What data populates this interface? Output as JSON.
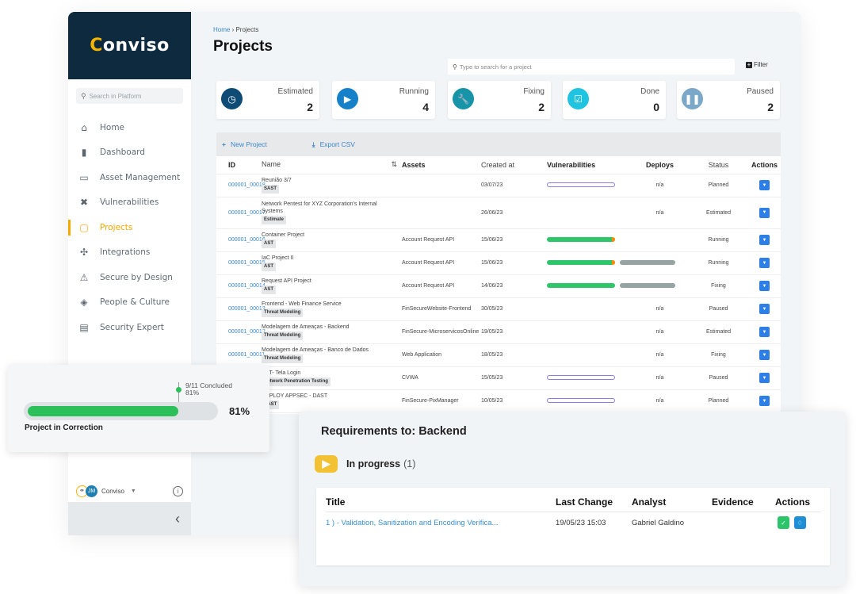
{
  "brand": {
    "logo_prefix": "C",
    "logo_rest": "onviso"
  },
  "sidebar": {
    "search_placeholder": "Search in Platform",
    "items": [
      {
        "label": "Home",
        "icon": "home-icon",
        "glyph": "⌂",
        "active": false
      },
      {
        "label": "Dashboard",
        "icon": "bar-chart-icon",
        "glyph": "▮",
        "active": false
      },
      {
        "label": "Asset Management",
        "icon": "devices-icon",
        "glyph": "▭",
        "active": false
      },
      {
        "label": "Vulnerabilities",
        "icon": "bug-icon",
        "glyph": "✖",
        "active": false
      },
      {
        "label": "Projects",
        "icon": "folder-icon",
        "glyph": "▢",
        "active": true
      },
      {
        "label": "Integrations",
        "icon": "puzzle-icon",
        "glyph": "✣",
        "active": false
      },
      {
        "label": "Secure by Design",
        "icon": "warning-triangle-icon",
        "glyph": "⚠",
        "active": false
      },
      {
        "label": "People & Culture",
        "icon": "graduation-cap-icon",
        "glyph": "◈",
        "active": false
      },
      {
        "label": "Security Expert",
        "icon": "chat-icon",
        "glyph": "▤",
        "active": false
      }
    ],
    "footer": {
      "avatar_org": "∞",
      "avatar_user": "JM",
      "org_name": "Conviso"
    }
  },
  "header": {
    "breadcrumb_home": "Home",
    "breadcrumb_sep": " › ",
    "breadcrumb_current": "Projects",
    "title": "Projects",
    "search_placeholder": "Type to search for a project",
    "filter_label": "Filter"
  },
  "stats": [
    {
      "label": "Estimated",
      "value": "2",
      "icon": "clock-icon",
      "glyph": "◷",
      "color": "#0f4c75"
    },
    {
      "label": "Running",
      "value": "4",
      "icon": "play-icon",
      "glyph": "▶",
      "color": "#1680c8"
    },
    {
      "label": "Fixing",
      "value": "2",
      "icon": "wrench-icon",
      "glyph": "🔧",
      "color": "#1794a8"
    },
    {
      "label": "Done",
      "value": "0",
      "icon": "check-square-icon",
      "glyph": "☑",
      "color": "#20c4e0"
    },
    {
      "label": "Paused",
      "value": "2",
      "icon": "pause-icon",
      "glyph": "❚❚",
      "color": "#7ba7c9"
    }
  ],
  "toolbar": {
    "new_project": "New Project",
    "export_csv": "Export CSV"
  },
  "table": {
    "columns": [
      "ID",
      "Name",
      "Assets",
      "Created at",
      "Vulnerabilities",
      "Deploys",
      "Status",
      "Actions"
    ],
    "rows": [
      {
        "id": "000001_00018",
        "name": "Reunião 3/7",
        "tag": "SAST",
        "assets": "",
        "created": "03/07/23",
        "vuln": "empty",
        "deploy_bar": false,
        "deploys": "n/a",
        "status": "Planned"
      },
      {
        "id": "000001_00017",
        "name": "Network Pentest for XYZ Corporation's Internal Systems",
        "tag": "Estimate",
        "assets": "",
        "created": "26/06/23",
        "vuln": "none",
        "deploy_bar": false,
        "deploys": "n/a",
        "status": "Estimated"
      },
      {
        "id": "000001_00016",
        "name": "Container Project",
        "tag": "AST",
        "assets": "Account Request API",
        "created": "15/06/23",
        "vuln": "green-orange",
        "deploy_bar": false,
        "deploys": "",
        "status": "Running"
      },
      {
        "id": "000001_00015",
        "name": "IaC Project II",
        "tag": "AST",
        "assets": "Account Request API",
        "created": "15/06/23",
        "vuln": "green-orange",
        "deploy_bar": true,
        "deploys": "",
        "status": "Running"
      },
      {
        "id": "000001_00014",
        "name": "Request API Project",
        "tag": "AST",
        "assets": "Account Request API",
        "created": "14/06/23",
        "vuln": "green",
        "deploy_bar": true,
        "deploys": "",
        "status": "Fixing"
      },
      {
        "id": "000001_00013",
        "name": "Frontend - Web Finance Service",
        "tag": "Threat Modeling",
        "assets": "FinSecureWebsite-Frontend",
        "created": "30/05/23",
        "vuln": "none",
        "deploy_bar": false,
        "deploys": "n/a",
        "status": "Paused"
      },
      {
        "id": "000001_00012",
        "name": "Modelagem de Ameaças - Backend",
        "tag": "Threat Modeling",
        "assets": "FinSecure-MicroservicosOnline",
        "created": "19/05/23",
        "vuln": "none",
        "deploy_bar": false,
        "deploys": "n/a",
        "status": "Estimated"
      },
      {
        "id": "000001_00011",
        "name": "Modelagem de Ameaças - Banco de Dados",
        "tag": "Threat Modeling",
        "assets": "Web Application",
        "created": "18/05/23",
        "vuln": "none",
        "deploy_bar": false,
        "deploys": "n/a",
        "status": "Fixing"
      },
      {
        "id": "",
        "name": "AST- Tela Login",
        "tag": "Network Penetration Testing",
        "assets": "CVWA",
        "created": "15/05/23",
        "vuln": "empty",
        "deploy_bar": false,
        "deploys": "n/a",
        "status": "Paused"
      },
      {
        "id": "",
        "name": "DEPLOY APPSEC - DAST",
        "tag": "DAST",
        "assets": "FinSecure-PixManager",
        "created": "10/05/23",
        "vuln": "empty",
        "deploy_bar": false,
        "deploys": "n/a",
        "status": "Planned"
      }
    ]
  },
  "progress_card": {
    "note_line1": "9/11 Concluded",
    "note_line2": "81%",
    "percent_label": "81%",
    "percent": 81,
    "label": "Project in Correction"
  },
  "requirements": {
    "title": "Requirements to: Backend",
    "status_label": "In progress",
    "status_count": "(1)",
    "columns": [
      "Title",
      "Last Change",
      "Analyst",
      "Evidence",
      "Actions"
    ],
    "rows": [
      {
        "title": "1 ) - Validation, Sanitization and Encoding Verifica...",
        "last_change": "19/05/23 15:03",
        "analyst": "Gabriel Galdino",
        "evidence": ""
      }
    ]
  }
}
